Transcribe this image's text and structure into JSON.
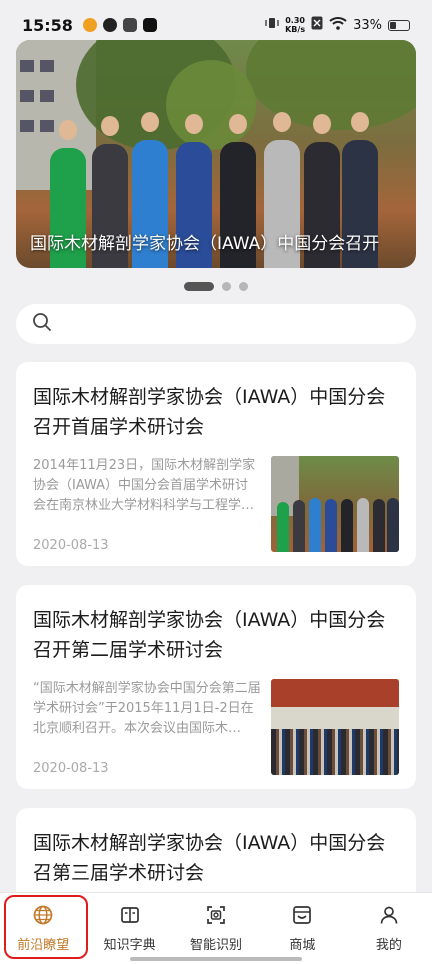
{
  "status_bar": {
    "time": "15:58",
    "net_speed_value": "0.30",
    "net_speed_unit": "KB/s",
    "battery": "33%",
    "battery_level": 0.33
  },
  "banner": {
    "caption": "国际木材解剖学家协会（IAWA）中国分会召开",
    "pager_count": 3,
    "pager_active": 0
  },
  "search": {
    "placeholder": ""
  },
  "articles": [
    {
      "title": "国际木材解剖学家协会（IAWA）中国分会召开首届学术研讨会",
      "summary": "2014年11月23日，国际木材解剖学家协会（IAWA）中国分会首届学术研讨会在南京林业大学材料科学与工程学…",
      "date": "2020-08-13"
    },
    {
      "title": "国际木材解剖学家协会（IAWA）中国分会召开第二届学术研讨会",
      "summary": "“国际木材解剖学家协会中国分会第二届学术研讨会”于2015年11月1日-2日在北京顺利召开。本次会议由国际木…",
      "date": "2020-08-13"
    },
    {
      "title": "国际木材解剖学家协会（IAWA）中国分会召第三届学术研讨会"
    }
  ],
  "nav": {
    "items": [
      {
        "label": "前沿瞭望",
        "icon": "globe-icon"
      },
      {
        "label": "知识字典",
        "icon": "book-icon"
      },
      {
        "label": "智能识别",
        "icon": "scan-icon"
      },
      {
        "label": "商城",
        "icon": "store-icon"
      },
      {
        "label": "我的",
        "icon": "user-icon"
      }
    ],
    "active_index": 0
  },
  "colors": {
    "accent": "#c27a2b",
    "highlight_box": "#e01b1b"
  }
}
